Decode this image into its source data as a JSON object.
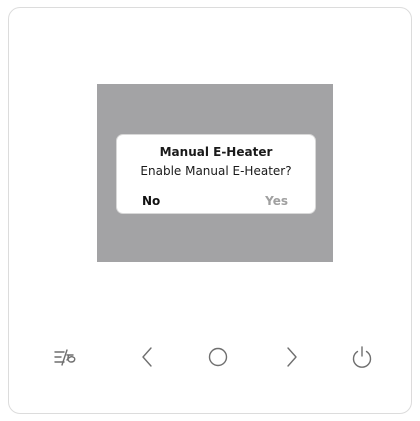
{
  "dialog": {
    "title": "Manual E-Heater",
    "message": "Enable Manual E-Heater?",
    "no_label": "No",
    "yes_label": "Yes"
  },
  "panel_keys": [
    {
      "icon": "lock-mode-icon"
    },
    {
      "icon": "chevron-left-icon"
    },
    {
      "icon": "circle-ok-icon"
    },
    {
      "icon": "chevron-right-icon"
    },
    {
      "icon": "power-icon"
    }
  ],
  "colors": {
    "screen_background": "#a3a3a5",
    "dialog_background": "#ffffff",
    "active_option": "#111111",
    "inactive_option": "#a0a0a0",
    "key_icon": "#6f6f6f"
  }
}
